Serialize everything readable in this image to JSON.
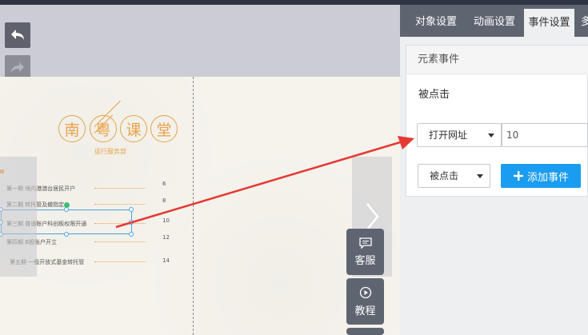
{
  "canvas": {
    "title_chars": [
      "南",
      "粤",
      "课",
      "堂"
    ],
    "subtitle": "运行服务部",
    "rows": [
      {
        "label": "第一期  境内港澳台居民开户",
        "num": "6"
      },
      {
        "label": "第二期  转托管及撤指定",
        "num": "8"
      },
      {
        "label": "第三期  普通账户科创板权限开通",
        "num": "10"
      },
      {
        "label": "第四期  B股账户开立",
        "num": "12"
      },
      {
        "label": "第五期  一般开放式基金转托管",
        "num": "14"
      }
    ]
  },
  "side_buttons": {
    "service": "客服",
    "tutorial": "教程"
  },
  "panel": {
    "tabs": [
      "对象设置",
      "动画设置",
      "事件设置",
      "多"
    ],
    "active_tab": "事件设置",
    "section_title": "元素事件",
    "event_label": "被点击",
    "action_select": "打开网址",
    "url_value": "10",
    "trigger_select": "被点击",
    "add_button": "添加事件"
  },
  "colors": {
    "accent": "#1a9cf0",
    "title_orange": "#e8a24a",
    "tab_bar": "#5f6570",
    "arrow": "#e53935",
    "selection": "#4aa3df"
  }
}
